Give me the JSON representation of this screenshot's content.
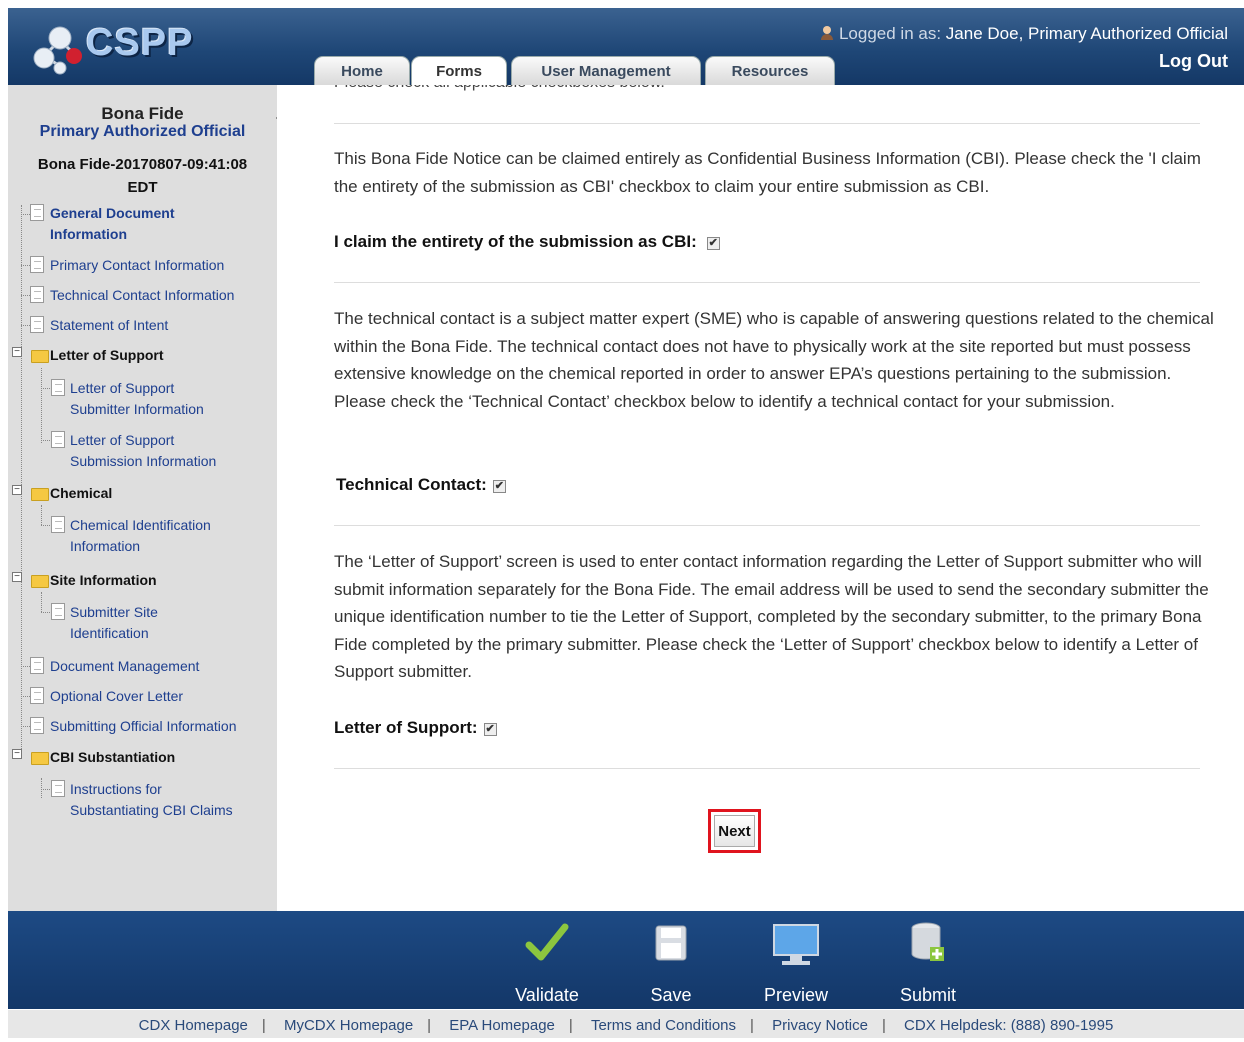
{
  "header": {
    "logo_text": "CSPP",
    "logged_in_prefix": "Logged in as:",
    "logged_in_user": "Jane Doe, Primary Authorized Official",
    "logout": "Log Out",
    "tabs": [
      {
        "label": "Home",
        "active": false
      },
      {
        "label": "Forms",
        "active": true
      },
      {
        "label": "User Management",
        "active": false
      },
      {
        "label": "Resources",
        "active": false
      }
    ]
  },
  "sidebar": {
    "title": "Bona Fide",
    "role": "Primary Authorized Official",
    "document_id": "Bona Fide-20170807-09:41:08 EDT",
    "items": [
      {
        "label": "General Document Information",
        "type": "doc"
      },
      {
        "label": "Primary Contact Information",
        "type": "doc"
      },
      {
        "label": "Technical Contact Information",
        "type": "doc"
      },
      {
        "label": "Statement of Intent",
        "type": "doc"
      },
      {
        "label": "Letter of Support",
        "type": "folder"
      },
      {
        "label": "Letter of Support Submitter Information",
        "type": "doc"
      },
      {
        "label": "Letter of Support Submission Information",
        "type": "doc"
      },
      {
        "label": "Chemical",
        "type": "folder"
      },
      {
        "label": "Chemical Identification Information",
        "type": "doc"
      },
      {
        "label": "Site Information",
        "type": "folder"
      },
      {
        "label": "Submitter Site Identification",
        "type": "doc"
      },
      {
        "label": "Document Management",
        "type": "doc"
      },
      {
        "label": "Optional Cover Letter",
        "type": "doc"
      },
      {
        "label": "Submitting Official Information",
        "type": "doc"
      },
      {
        "label": "CBI Substantiation",
        "type": "folder"
      },
      {
        "label": "Instructions for Substantiating CBI Claims",
        "type": "doc"
      }
    ]
  },
  "main": {
    "cut_text": "Please check all applicable checkboxes below.",
    "cbi_paragraph": "This Bona Fide Notice can be claimed entirely as Confidential Business Information (CBI). Please check the 'I claim the entirety of the submission as CBI' checkbox to claim your entire submission as CBI.",
    "cbi_label": "I claim the entirety of the submission as CBI:",
    "cbi_checked": true,
    "tech_paragraph": "The technical contact is a subject matter expert (SME) who is capable of answering questions related to the chemical within the Bona Fide. The technical contact does not have to physically work at the site reported but must possess extensive knowledge on the chemical reported in order to answer EPA’s questions pertaining to the submission. Please check the ‘Technical Contact’ checkbox below to identify a technical contact for your submission.",
    "tech_label": "Technical Contact:",
    "tech_checked": true,
    "los_paragraph": "The ‘Letter of Support’ screen is used to enter contact information regarding the Letter of Support submitter who will submit information separately for the Bona Fide. The email address will be used to send the secondary submitter the unique identification number to tie the Letter of Support, completed by the secondary submitter, to the primary Bona Fide completed by the primary submitter. Please check the ‘Letter of Support’ checkbox below to identify a Letter of Support submitter.",
    "los_label": "Letter of Support:",
    "los_checked": true,
    "next_button": "Next"
  },
  "actions": {
    "validate": "Validate",
    "save": "Save",
    "preview": "Preview",
    "submit": "Submit"
  },
  "footer": {
    "links": [
      "CDX Homepage",
      "MyCDX Homepage",
      "EPA Homepage",
      "Terms and Conditions",
      "Privacy Notice",
      "CDX Helpdesk: (888) 890-1995"
    ]
  }
}
